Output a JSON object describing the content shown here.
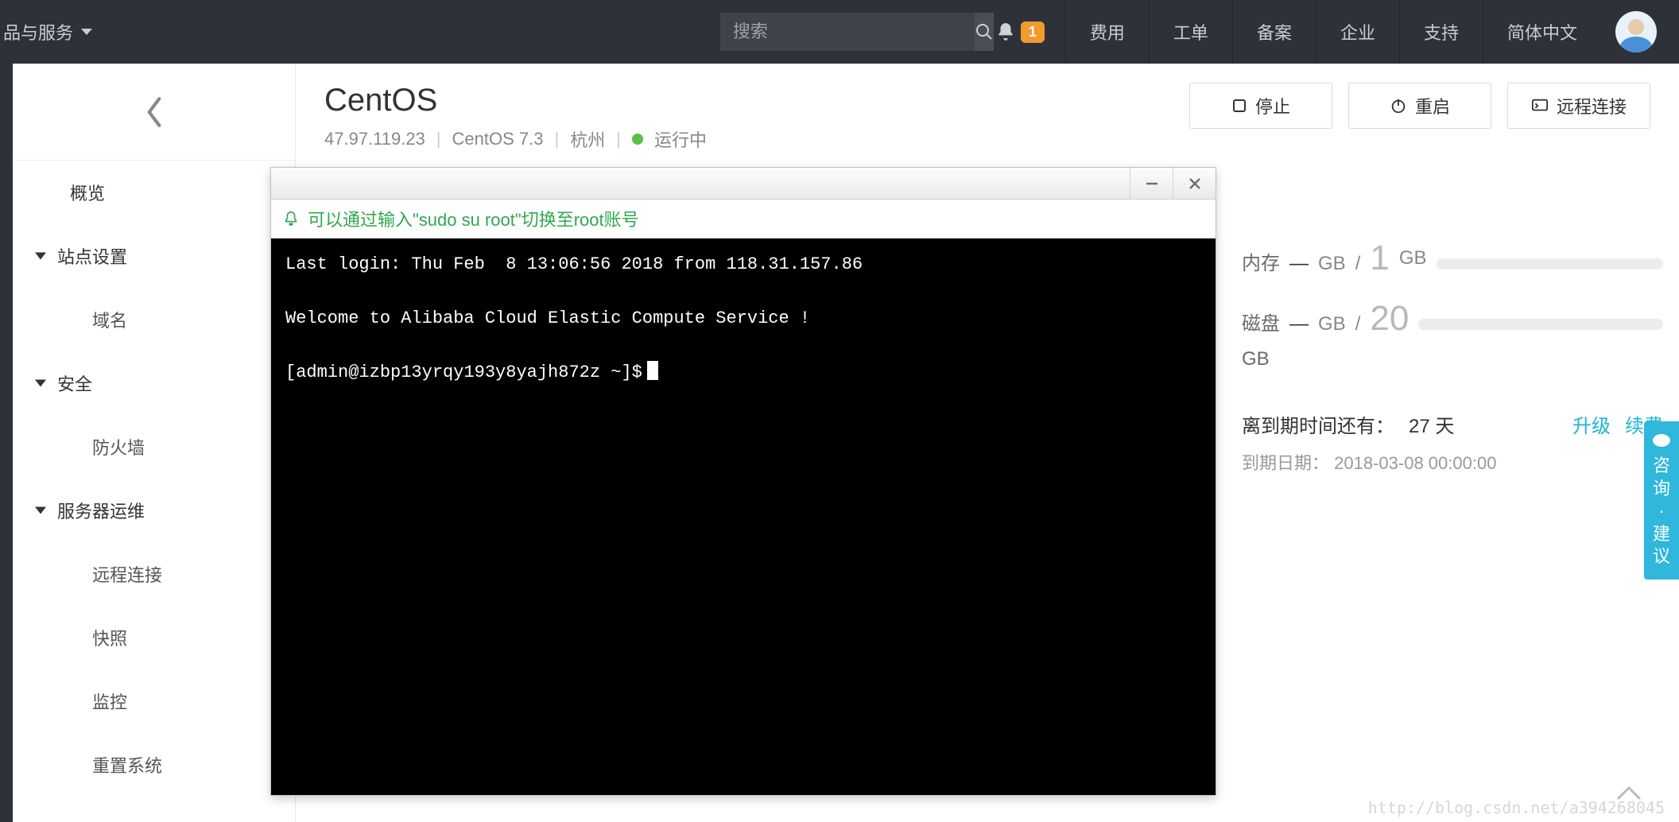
{
  "topbar": {
    "products_label": "品与服务",
    "search_placeholder": "搜索",
    "notification_count": "1",
    "items": [
      "费用",
      "工单",
      "备案",
      "企业",
      "支持",
      "简体中文"
    ]
  },
  "sidebar": {
    "overview": "概览",
    "sections": [
      {
        "label": "站点设置",
        "children": [
          "域名"
        ]
      },
      {
        "label": "安全",
        "children": [
          "防火墙"
        ]
      },
      {
        "label": "服务器运维",
        "children": [
          "远程连接",
          "快照",
          "监控",
          "重置系统"
        ]
      }
    ]
  },
  "server": {
    "title": "CentOS",
    "ip": "47.97.119.23",
    "os": "CentOS 7.3",
    "region": "杭州",
    "status": "运行中",
    "actions": {
      "stop": "停止",
      "restart": "重启",
      "remote": "远程连接"
    }
  },
  "info": {
    "mem_label": "内存",
    "mem_used_placeholder": "—",
    "mem_unit": "GB",
    "mem_sep": "/",
    "mem_total": "1",
    "disk_label": "磁盘",
    "disk_used_placeholder": "—",
    "disk_unit": "GB",
    "disk_sep": "/",
    "disk_total": "20",
    "disk_total_unit": "GB",
    "expire_label": "离到期时间还有：",
    "expire_days": "27 天",
    "upgrade": "升级",
    "renew": "续费",
    "expire_date_label": "到期日期：",
    "expire_date": "2018-03-08 00:00:00"
  },
  "terminal": {
    "hint": "可以通过输入\"sudo su root\"切换至root账号",
    "line1": "Last login: Thu Feb  8 13:06:56 2018 from 118.31.157.86",
    "line2": "Welcome to Alibaba Cloud Elastic Compute Service !",
    "prompt": "[admin@izbp13yrqy193y8yajh872z ~]$"
  },
  "feedback": "咨询 · 建议",
  "watermark": "http://blog.csdn.net/a394268045"
}
